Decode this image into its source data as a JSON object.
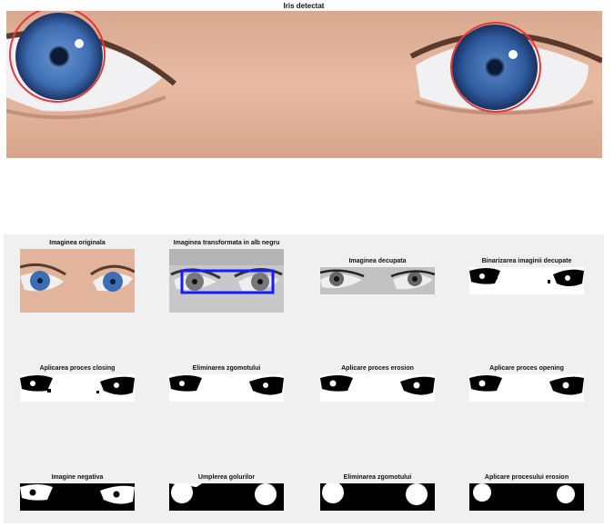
{
  "top_figure": {
    "title": "Iris detectat",
    "circle_color": "#e03a3a"
  },
  "grid": {
    "row1": {
      "original": "Imaginea originala",
      "bw": "Imaginea transformata in alb negru",
      "cropped": "Imaginea decupata",
      "binarized": "Binarizarea imaginii decupate"
    },
    "row2": {
      "closing": "Aplicarea proces closing",
      "noise1": "Eliminarea zgomotului",
      "erosion1": "Aplicare proces erosion",
      "opening": "Aplicare proces opening"
    },
    "row3": {
      "negative": "Imagine negativa",
      "fill": "Umplerea golurilor",
      "noise2": "Eliminarea zgomotului",
      "erosion2": "Aplicare procesului erosion"
    },
    "box_color": "#1a1aff"
  }
}
